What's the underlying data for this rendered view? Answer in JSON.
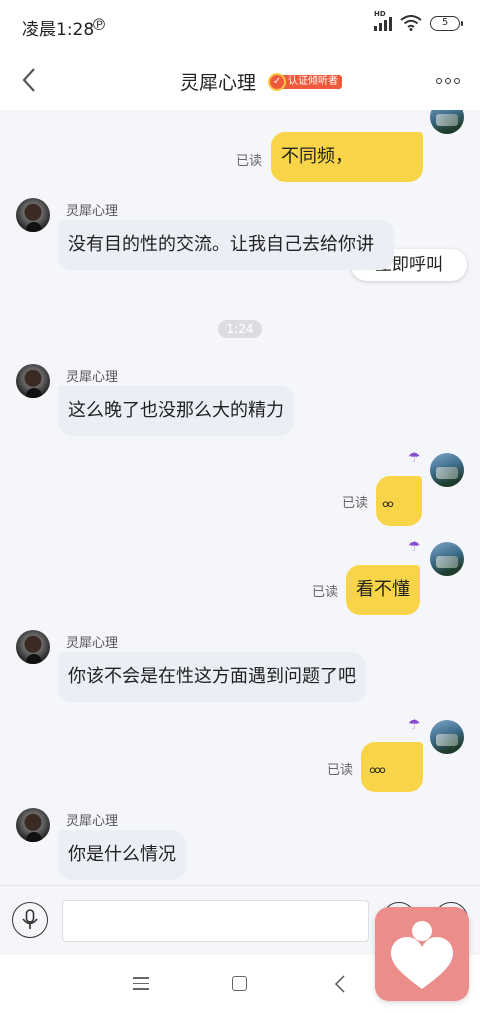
{
  "status_bar": {
    "time": "凌晨1:28",
    "battery": "5",
    "network_label": "HD"
  },
  "header": {
    "title": "灵犀心理",
    "badge_text": "认证倾听者"
  },
  "messages": {
    "m1": {
      "read": "已读",
      "text": "不同频，"
    },
    "call_button": "立即呼叫",
    "m2": {
      "sender": "灵犀心理",
      "text": "没有目的性的交流。让我自己去给你讲"
    },
    "timestamp": "1:24",
    "m3": {
      "sender": "灵犀心理",
      "text": "这么晚了也没那么大的精力"
    },
    "m4": {
      "read": "已读",
      "text": "。。"
    },
    "m5": {
      "read": "已读",
      "text": "看不懂"
    },
    "m6": {
      "sender": "灵犀心理",
      "text": "你该不会是在性这方面遇到问题了吧"
    },
    "m7": {
      "read": "已读",
      "text": "。。。"
    },
    "m8": {
      "sender": "灵犀心理",
      "text": "你是什么情况"
    }
  },
  "input_bar": {
    "placeholder": ""
  },
  "icons": [
    "back-icon",
    "more-icon",
    "bluetooth-icon",
    "wifi-icon",
    "mic-icon",
    "emoji-icon",
    "plus-icon",
    "umbrella-icon",
    "heart-icon"
  ],
  "colors": {
    "accent_yellow": "#f8d548",
    "left_bubble": "#ebeef5",
    "badge_red": "#ef5a3c",
    "widget_pink": "#ea8d8b"
  }
}
